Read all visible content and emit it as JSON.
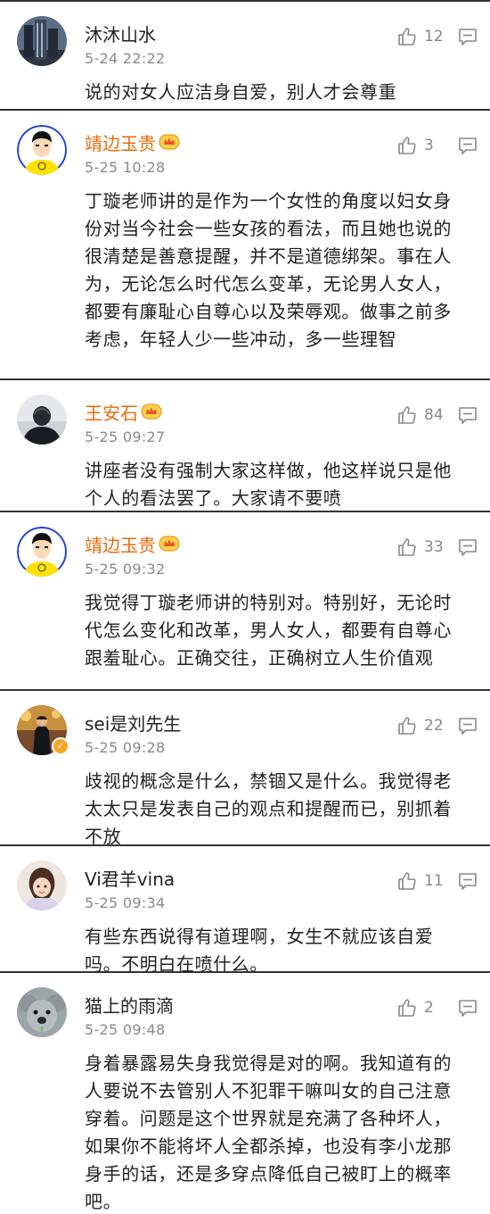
{
  "comments": [
    {
      "name": "沐沐山水",
      "time": "5-24 22:22",
      "likes": "12",
      "text": "说的对女人应洁身自爱，别人才会尊重"
    },
    {
      "name": "靖边玉贵",
      "time": "5-25 10:28",
      "likes": "3",
      "text": "丁璇老师讲的是作为一个女性的角度以妇女身份对当今社会一些女孩的看法，而且她也说的很清楚是善意提醒，并不是道德绑架。事在人为，无论怎么时代怎么变革，无论男人女人，都要有廉耻心自尊心以及荣辱观。做事之前多考虑，年轻人少一些冲动，多一些理智"
    },
    {
      "name": "王安石",
      "time": "5-25 09:27",
      "likes": "84",
      "text": "讲座者没有强制大家这样做，他这样说只是他个人的看法罢了。大家请不要喷"
    },
    {
      "name": "靖边玉贵",
      "time": "5-25 09:32",
      "likes": "33",
      "text": "我觉得丁璇老师讲的特别对。特别好，无论时代怎么变化和改革，男人女人，都要有自尊心跟羞耻心。正确交往，正确树立人生价值观"
    },
    {
      "name": "sei是刘先生",
      "time": "5-25 09:28",
      "likes": "22",
      "text": "歧视的概念是什么，禁锢又是什么。我觉得老太太只是发表自己的观点和提醒而已，别抓着不放"
    },
    {
      "name": "Vi君羊vina",
      "time": "5-25 09:34",
      "likes": "11",
      "text": "有些东西说得有道理啊，女生不就应该自爱吗。不明白在喷什么。"
    },
    {
      "name": "猫上的雨滴",
      "time": "5-25 09:48",
      "likes": "2",
      "text": "身着暴露易失身我觉得是对的啊。我知道有的人要说不去管别人不犯罪干嘛叫女的自己注意穿着。问题是这个世界就是充满了各种坏人，如果你不能将坏人全都杀掉，也没有李小龙那身手的话，还是多穿点降低自己被盯上的概率吧。"
    }
  ],
  "colors": {
    "vip_name": "#e86b0c",
    "meta": "#8a8a8a",
    "divider": "#333333",
    "badge": "#f6a623"
  }
}
